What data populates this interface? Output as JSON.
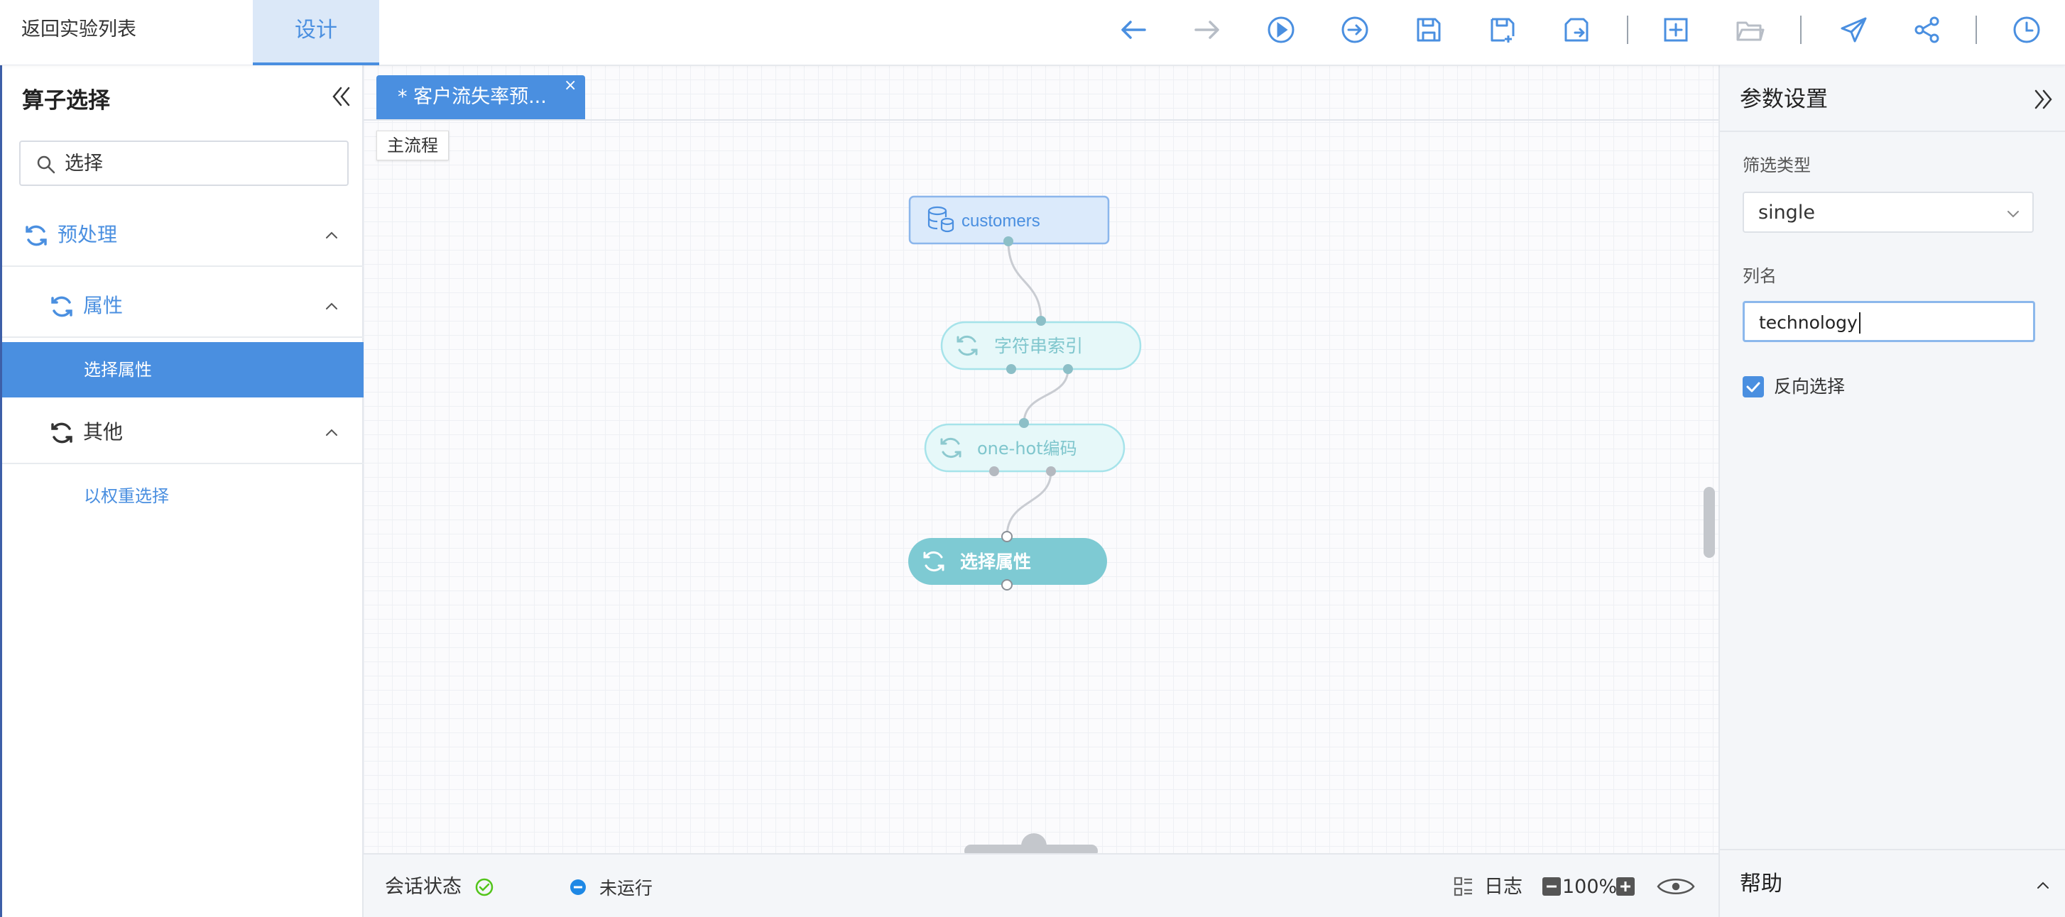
{
  "header": {
    "back_label": "返回实验列表",
    "tab_design": "设计",
    "toolbar": [
      "undo-icon",
      "redo-icon",
      "run-icon",
      "run-from-here-icon",
      "save-icon",
      "save-as-icon",
      "export-icon",
      "add-icon",
      "open-folder-icon",
      "publish-icon",
      "share-icon",
      "history-icon"
    ]
  },
  "left_panel": {
    "title": "算子选择",
    "search_value": "选择",
    "tree": {
      "group": "预处理",
      "sub1": "属性",
      "sub1_leaf": "选择属性",
      "sub2": "其他",
      "sub2_leaf": "以权重选择"
    }
  },
  "canvas": {
    "tab_label": "* 客户流失率预...",
    "tab_close": "×",
    "main_flow": "主流程",
    "nodes": {
      "customers": "customers",
      "string_index": "字符串索引",
      "onehot": "one-hot编码",
      "select_attr": "选择属性"
    }
  },
  "status_bar": {
    "session_label": "会话状态",
    "run_status": "未运行",
    "log_label": "日志",
    "zoom": "100%"
  },
  "right_panel": {
    "title": "参数设置",
    "filter_type_label": "筛选类型",
    "filter_type_value": "single",
    "column_label": "列名",
    "column_value": "technology",
    "invert_label": "反向选择",
    "invert_checked": true,
    "help_label": "帮助"
  },
  "colors": {
    "accent": "#4a8fe0",
    "node_data_fill": "#dbeafb",
    "node_soft_fill": "#e6f8f9",
    "node_active_fill": "#7ecad3",
    "success": "#52c41a"
  }
}
